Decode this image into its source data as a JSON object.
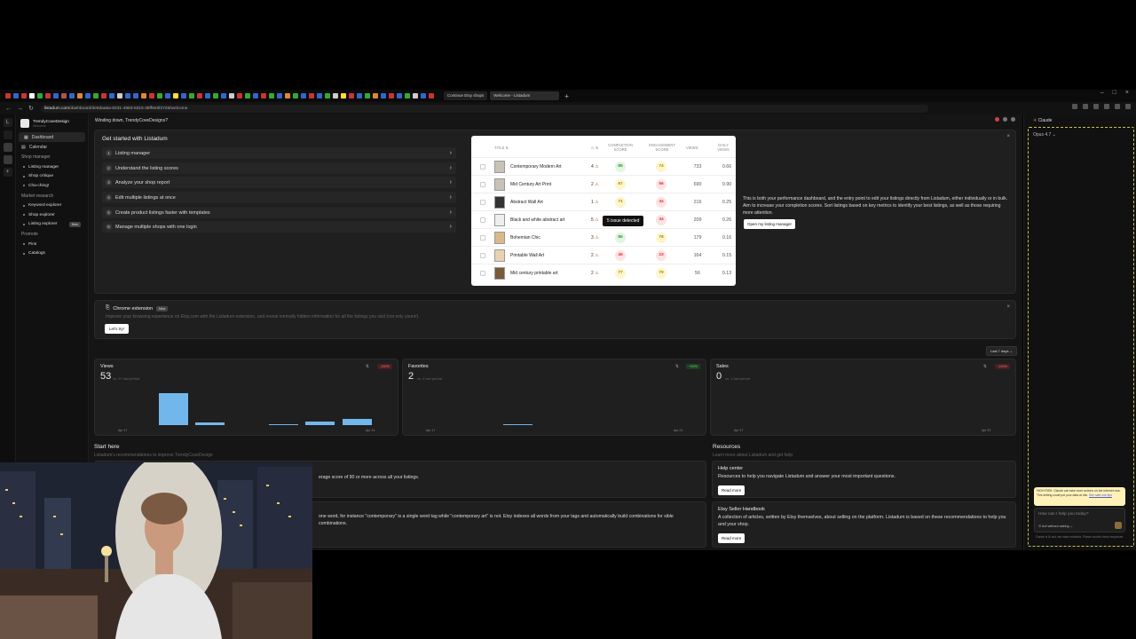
{
  "browser": {
    "tabs": [
      {
        "label": "Continue Etsy shops"
      },
      {
        "label": "Welcome - Listadum"
      }
    ],
    "url_host": "listadum.com",
    "url_path": "/dashboard/de9daa5a-8231-4983-8315-38ff8e5f2726/welcome"
  },
  "sidebar": {
    "shop_name": "TrendyCoveDesign",
    "shop_sub": "Welcome",
    "nav": [
      {
        "label": "Dashboard"
      },
      {
        "label": "Calendar"
      }
    ],
    "sections": [
      {
        "title": "Shop manager",
        "items": [
          "Listing manager",
          "Shop critique",
          "Cha-ching!"
        ]
      },
      {
        "title": "Market research",
        "items": [
          "Keyword explorer",
          "Shop explorer",
          "Listing explorer"
        ]
      },
      {
        "title": "Promote",
        "items": [
          "Pins",
          "Catalogs"
        ]
      }
    ],
    "new_badge": "New"
  },
  "topbar": {
    "greeting": "Winding down, TrendyCoveDesigns?"
  },
  "get_started": {
    "title": "Get started with Listadum",
    "steps": [
      {
        "num": "1",
        "label": "Listing manager"
      },
      {
        "num": "2",
        "label": "Understand the listing scores"
      },
      {
        "num": "3",
        "label": "Analyze your shop report"
      },
      {
        "num": "4",
        "label": "Edit multiple listings at once"
      },
      {
        "num": "5",
        "label": "Create product listings faster with templates"
      },
      {
        "num": "6",
        "label": "Manage multiple shops with one login"
      }
    ]
  },
  "preview": {
    "headers": {
      "title": "TITLE",
      "completion": "COMPLETION SCORE",
      "engagement": "ENGAGEMENT SCORE",
      "views": "VIEWS",
      "daily": "DAILY VIEWS"
    },
    "rows": [
      {
        "title": "Contemporary Modern Art",
        "issues": "4",
        "completion": "85",
        "cclass": "pg",
        "engagement": "74",
        "eclass": "py",
        "views": "733",
        "daily": "0.66"
      },
      {
        "title": "Mid Century Art Print",
        "issues": "2",
        "completion": "67",
        "cclass": "py",
        "engagement": "56",
        "eclass": "pr",
        "views": "690",
        "daily": "0.90"
      },
      {
        "title": "Abstract Wall Art",
        "issues": "1",
        "completion": "71",
        "cclass": "py",
        "engagement": "34",
        "eclass": "pr",
        "views": "216",
        "daily": "0.25"
      },
      {
        "title": "Black and white abstract art",
        "issues": "5",
        "completion": "",
        "cclass": "py",
        "engagement": "34",
        "eclass": "pr",
        "views": "209",
        "daily": "0.26"
      },
      {
        "title": "Bohemian Chic",
        "issues": "3",
        "completion": "86",
        "cclass": "pg",
        "engagement": "78",
        "eclass": "py",
        "views": "179",
        "daily": "0.16"
      },
      {
        "title": "Printable Wall Art",
        "issues": "2",
        "completion": "45",
        "cclass": "pr",
        "engagement": "23",
        "eclass": "pr",
        "views": "164",
        "daily": "0.15"
      },
      {
        "title": "Mid century printable art",
        "issues": "2",
        "completion": "77",
        "cclass": "py",
        "engagement": "79",
        "eclass": "py",
        "views": "56",
        "daily": "0.13"
      }
    ],
    "tooltip": "5 issue detected"
  },
  "perf": {
    "text": "This is both your performance dashboard, and the entry point to edit your listings directly from Listadum, either individually or in bulk. Aim to increase your completion scores. Sort listings based on key metrics to identify your best listings, as well as those requiring more attention.",
    "button": "Open my listing manager"
  },
  "extension": {
    "title": "Chrome extension",
    "badge": "New",
    "desc": "Improve your browsing experience on Etsy.com with the Listadum extension, and reveal normally hidden information for all the listings you visit (not only yours!).",
    "button": "Let's try!"
  },
  "range": "Last 7 days",
  "stats": [
    {
      "title": "Views",
      "value": "53",
      "vs": "vs. 97 last period",
      "change": "-150%",
      "start": "Apr 17",
      "end": "Apr 23",
      "bars": [
        0,
        32,
        3,
        0,
        1,
        4,
        6
      ]
    },
    {
      "title": "Favorites",
      "value": "2",
      "vs": "vs. 4 last period",
      "change": "+40%",
      "start": "Apr 17",
      "end": "Apr 23",
      "bars": [
        0,
        0,
        1,
        0,
        0,
        0,
        0
      ]
    },
    {
      "title": "Sales",
      "value": "0",
      "vs": "vs. 1 last period",
      "change": "-100%",
      "start": "Apr 17",
      "end": "Apr 23",
      "bars": [
        0,
        0,
        0,
        0,
        0,
        0,
        0
      ]
    }
  ],
  "start_here": {
    "title": "Start here",
    "sub": "Listadum's recommendations to improve TrendyCoveDesign",
    "items": [
      {
        "text": "erage score of 90 or more across all your listings."
      },
      {
        "text": "one word, for instance \"contemporary\" is a single word tag while \"contemporary art\" is not. Etsy indexes all words from your tags and automatically build combinations for sible combinations."
      }
    ]
  },
  "resources": {
    "title": "Resources",
    "sub": "Learn more about Listadum and get help",
    "items": [
      {
        "title": "Help center",
        "desc": "Resources to help you navigate Listadum and answer your most important questions.",
        "button": "Read more"
      },
      {
        "title": "Etsy Seller Handbook",
        "desc": "A collection of articles, written by Etsy themselves, about selling on the platform. Listadum is based on these recommendations to help you and your shop.",
        "button": "Read more"
      }
    ]
  },
  "claude": {
    "title": "Claude",
    "model": "Opus 4.7",
    "warning": "HIGH RISK: Claude can take more actions on the internet now. This setting could put your data at risk.",
    "warning_link": "See safe use tips",
    "placeholder": "How can I help you today?",
    "mode": "Act without asking",
    "footer": "Claude is AI and can make mistakes. Please double-check responses."
  }
}
